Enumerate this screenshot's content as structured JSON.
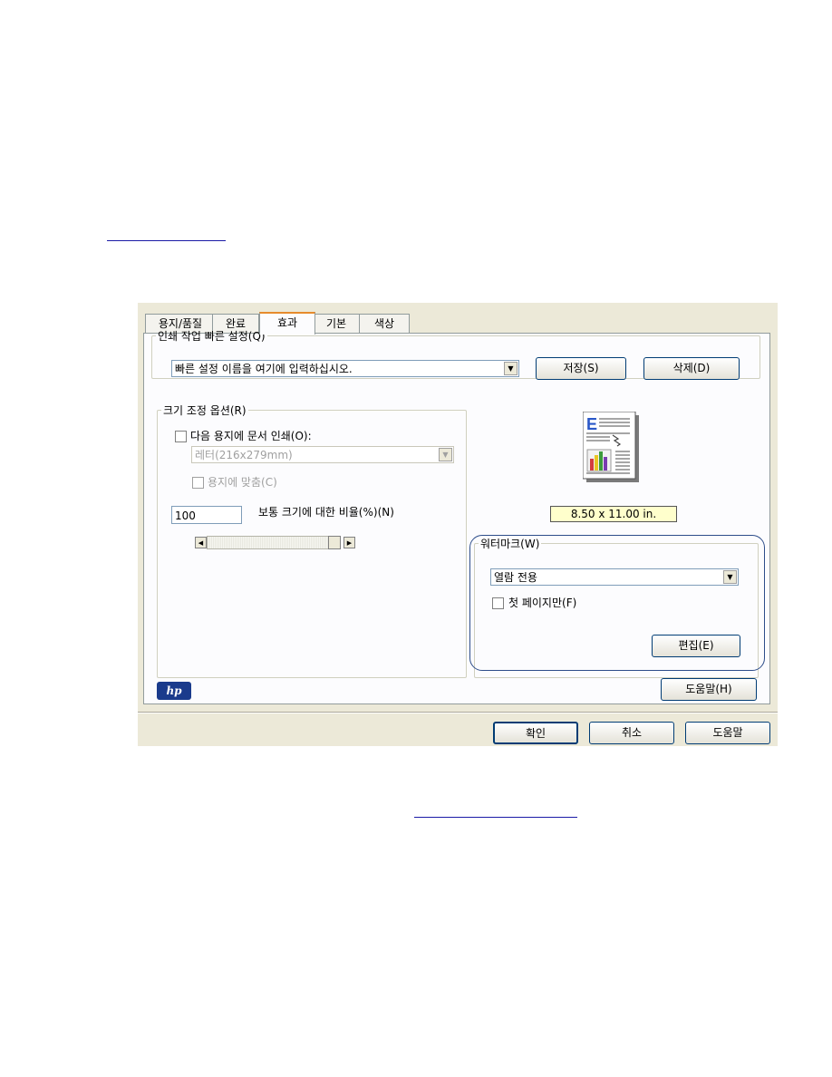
{
  "dialog": {
    "tabs": [
      {
        "label": "용지/품질"
      },
      {
        "label": "완료"
      },
      {
        "label": "효과"
      },
      {
        "label": "기본"
      },
      {
        "label": "색상"
      }
    ],
    "quick_set": {
      "legend": "인쇄 작업 빠른 설정(Q)",
      "input_value": "빠른 설정 이름을 여기에 입력하십시오.",
      "save_label": "저장(S)",
      "delete_label": "삭제(D)"
    },
    "resize": {
      "legend": "크기 조정 옵션(R)",
      "print_on_paper_label": "다음 용지에 문서 인쇄(O):",
      "paper_select_value": "레터(216x279mm)",
      "fit_to_paper_label": "용지에 맞춤(C)",
      "percent_value": "100",
      "percent_label": "보통 크기에 대한 비율(%)(N)"
    },
    "preview": {
      "size_text": "8.50 x 11.00 in."
    },
    "watermark": {
      "legend": "워터마크(W)",
      "select_value": "열람 전용",
      "first_page_only_label": "첫 페이지만(F)",
      "edit_label": "편집(E)"
    },
    "help_label": "도움말(H)",
    "logo_text": "hp",
    "footer": {
      "ok_label": "확인",
      "cancel_label": "취소",
      "help_label": "도움말"
    }
  },
  "colors": {
    "dialog_bg": "#ece9d8",
    "panel_bg": "#fcfcfe",
    "highlight_outline": "#2d4d8a",
    "size_label_bg": "#ffffcc",
    "link_underline": "#1a1aa6"
  }
}
